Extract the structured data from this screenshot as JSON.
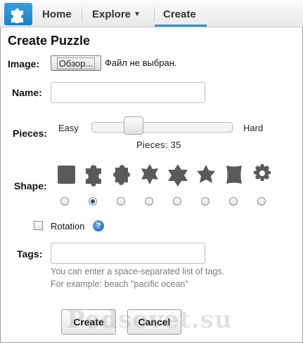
{
  "nav": {
    "logo_icon": "puzzle-piece-icon",
    "items": [
      {
        "label": "Home"
      },
      {
        "label": "Explore"
      },
      {
        "label": "Create"
      }
    ],
    "active": "Create",
    "explore_caret": "▼"
  },
  "page": {
    "title": "Create Puzzle"
  },
  "form": {
    "image_label": "Image:",
    "browse_label": "Обзор...",
    "file_status": "Файл не выбран.",
    "name_label": "Name:",
    "name_value": "",
    "pieces_label": "Pieces:",
    "easy_label": "Easy",
    "hard_label": "Hard",
    "pieces_value": 35,
    "pieces_text": "Pieces: 35",
    "shape_label": "Shape:",
    "shapes": [
      "square",
      "classic-jigsaw",
      "jigsaw-rounded",
      "star-6",
      "star-6-alt",
      "star-5",
      "curved-square",
      "gear"
    ],
    "selected_shape_index": 1,
    "rotation_label": "Rotation",
    "rotation_checked": false,
    "tags_label": "Tags:",
    "tags_value": "",
    "tags_hint_1": "You can enter a space-separated list of tags.",
    "tags_hint_2": "For example: beach \"pacific ocean\"",
    "create_label": "Create",
    "cancel_label": "Cancel"
  },
  "watermark": "Pedsovet.su",
  "colors": {
    "accent": "#2f8fd0",
    "logo": "#1f7fc4",
    "shape_fill": "#5a5a5a",
    "hint": "#7a7a7a"
  }
}
